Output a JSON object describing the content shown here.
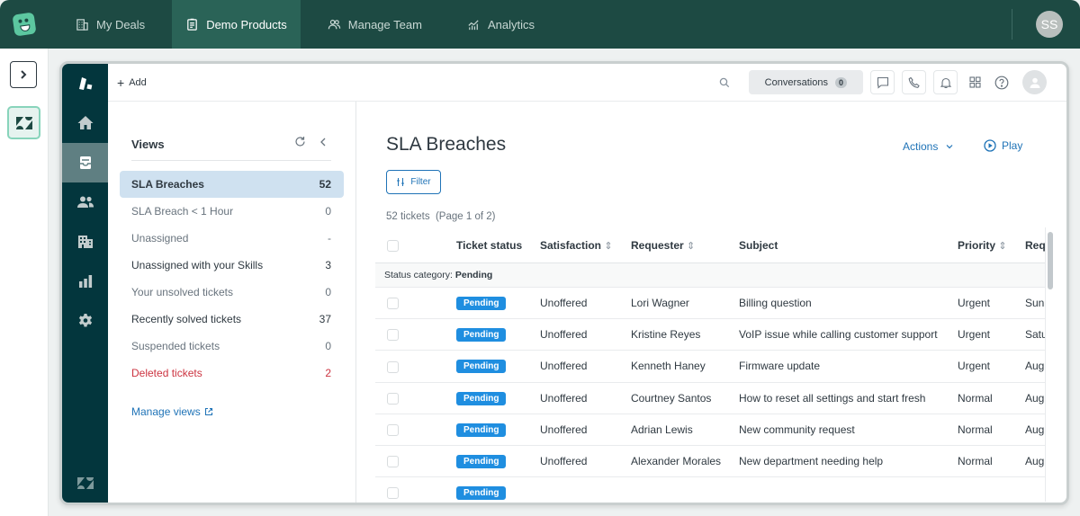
{
  "topbar": {
    "logo": "app-logo",
    "tabs": [
      {
        "label": "My Deals",
        "icon": "building-icon"
      },
      {
        "label": "Demo Products",
        "icon": "clipboard-icon",
        "active": true
      },
      {
        "label": "Manage Team",
        "icon": "team-icon"
      },
      {
        "label": "Analytics",
        "icon": "analytics-icon"
      }
    ],
    "user_initials": "SS"
  },
  "leftrail": {
    "expand_icon": "chevron-right-icon",
    "app_icon": "zendesk-icon"
  },
  "zendesk": {
    "header": {
      "add_label": "Add",
      "conversations_label": "Conversations",
      "conversations_count": "0"
    },
    "views": {
      "title": "Views",
      "items": [
        {
          "label": "SLA Breaches",
          "count": "52",
          "state": "active"
        },
        {
          "label": "SLA Breach < 1 Hour",
          "count": "0",
          "state": "muted"
        },
        {
          "label": "Unassigned",
          "count": "-",
          "state": "muted"
        },
        {
          "label": "Unassigned with your Skills",
          "count": "3",
          "state": "dark"
        },
        {
          "label": "Your unsolved tickets",
          "count": "0",
          "state": "muted"
        },
        {
          "label": "Recently solved tickets",
          "count": "37",
          "state": "dark"
        },
        {
          "label": "Suspended tickets",
          "count": "0",
          "state": "muted"
        },
        {
          "label": "Deleted tickets",
          "count": "2",
          "state": "deleted"
        }
      ],
      "manage_label": "Manage views"
    },
    "main": {
      "title": "SLA Breaches",
      "actions_label": "Actions",
      "play_label": "Play",
      "filter_label": "Filter",
      "ticket_count": "52 tickets  (Page 1 of 2)",
      "columns": [
        "Ticket status",
        "Satisfaction",
        "Requester",
        "Subject",
        "Priority",
        "Req"
      ],
      "group_label": "Status category:",
      "group_value": "Pending",
      "rows": [
        {
          "status": "Pending",
          "satisfaction": "Unoffered",
          "requester": "Lori Wagner",
          "subject": "Billing question",
          "priority": "Urgent",
          "requested": "Sun"
        },
        {
          "status": "Pending",
          "satisfaction": "Unoffered",
          "requester": "Kristine Reyes",
          "subject": "VoIP issue while calling customer support",
          "priority": "Urgent",
          "requested": "Satu"
        },
        {
          "status": "Pending",
          "satisfaction": "Unoffered",
          "requester": "Kenneth Haney",
          "subject": "Firmware update",
          "priority": "Urgent",
          "requested": "Aug"
        },
        {
          "status": "Pending",
          "satisfaction": "Unoffered",
          "requester": "Courtney Santos",
          "subject": "How to reset all settings and start fresh",
          "priority": "Normal",
          "requested": "Aug"
        },
        {
          "status": "Pending",
          "satisfaction": "Unoffered",
          "requester": "Adrian Lewis",
          "subject": "New community request",
          "priority": "Normal",
          "requested": "Aug"
        },
        {
          "status": "Pending",
          "satisfaction": "Unoffered",
          "requester": "Alexander Morales",
          "subject": "New department needing help",
          "priority": "Normal",
          "requested": "Aug"
        },
        {
          "status": "Pending",
          "satisfaction": "",
          "requester": "",
          "subject": "",
          "priority": "",
          "requested": ""
        }
      ]
    }
  },
  "colors": {
    "topbar": "#1d4a43",
    "active_tab": "#2a6357",
    "zd_nav": "#03363d",
    "link": "#1f73b7",
    "badge": "#1f8ee0",
    "active_view": "#cfe1f0",
    "deleted": "#cc3340"
  }
}
